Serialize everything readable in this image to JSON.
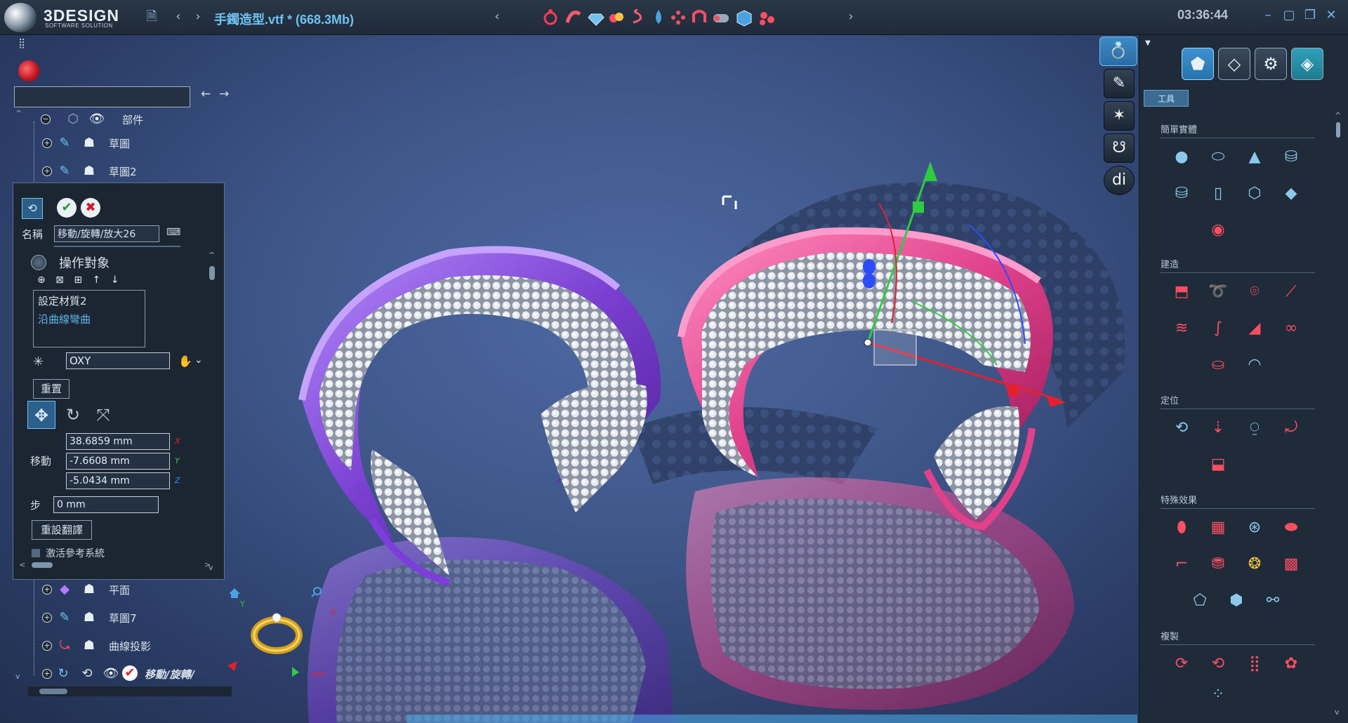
{
  "app": {
    "brand": "3DESIGN",
    "brand_sub": "SOFTWARE SOLUTION",
    "document_title": "手鐲造型.vtf * (668.3Mb)",
    "clock": "03:36:44"
  },
  "titlebar_icons": [
    "save-icon",
    "back-icon",
    "forward-icon",
    "ring-icon",
    "bend-icon",
    "gem-icon",
    "material-icon",
    "spiral-icon",
    "drop-icon",
    "pattern-icon",
    "ring-bead-icon",
    "link-icon",
    "cube-icon",
    "cluster-icon"
  ],
  "tree": {
    "search_placeholder": "",
    "rows_top": [
      {
        "label": "部件",
        "icon": "layers-icon"
      },
      {
        "label": "草圖",
        "icon": "sketch-icon"
      },
      {
        "label": "草圖2",
        "icon": "sketch-icon"
      }
    ],
    "rows_bottom": [
      {
        "label": "平面",
        "icon": "plane-icon"
      },
      {
        "label": "草圖7",
        "icon": "sketch-icon"
      },
      {
        "label": "曲線投影",
        "icon": "curve-projection-icon"
      },
      {
        "label": "移動/旋轉/",
        "icon": "move-rotate-icon"
      }
    ]
  },
  "dialog": {
    "name_label": "名稱",
    "name_value": "移動/旋轉/放大26",
    "operation_title": "操作對象",
    "operation_tools": "⊕ ⊠ ⊞ ↑ ↓",
    "operation_items": [
      {
        "label": "設定材質2",
        "color": "#d9e1e8"
      },
      {
        "label": "沿曲線彎曲",
        "color": "#5db6ea"
      }
    ],
    "plane_value": "OXY",
    "reset_label": "重置",
    "move_label": "移動",
    "x_value": "38.6859 mm",
    "y_value": "-7.6608 mm",
    "z_value": "-5.0434 mm",
    "axis_x": "X",
    "axis_y": "Y",
    "axis_z": "Z",
    "step_label": "步",
    "step_value": "0 mm",
    "reflip_label": "重設翻譯",
    "ref_system_label": "激活參考系統"
  },
  "gizmo_axes": {
    "y": "Y",
    "x": "X"
  },
  "right_panel": {
    "tools_tab_label": "工具",
    "sections": [
      {
        "title": "簡單實體"
      },
      {
        "title": "建造"
      },
      {
        "title": "定位"
      },
      {
        "title": "特殊效果"
      },
      {
        "title": "複製"
      }
    ]
  },
  "colors": {
    "accent": "#6ec1f0",
    "viewport_bg": "#3f5689",
    "bracelet_left": "#8c4fd8",
    "bracelet_right": "#e0418a",
    "tool_red": "#ff4d63"
  }
}
